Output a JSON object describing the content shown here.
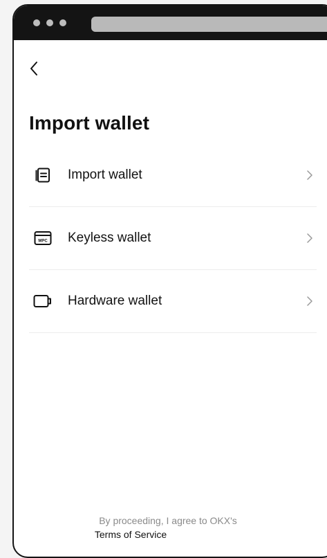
{
  "header": {
    "back_icon": "chevron-left-icon"
  },
  "page": {
    "title": "Import wallet"
  },
  "options": [
    {
      "label": "Import wallet",
      "icon": "document-list-icon"
    },
    {
      "label": "Keyless wallet",
      "icon": "mpc-card-icon",
      "icon_text": "MPC"
    },
    {
      "label": "Hardware wallet",
      "icon": "hardware-device-icon"
    }
  ],
  "footer": {
    "consent_text": "By proceeding, I agree to OKX's",
    "terms_link": "Terms of Service"
  },
  "colors": {
    "frame": "#141414",
    "text": "#121212",
    "muted": "#8a8a8a",
    "divider": "#ececec"
  }
}
